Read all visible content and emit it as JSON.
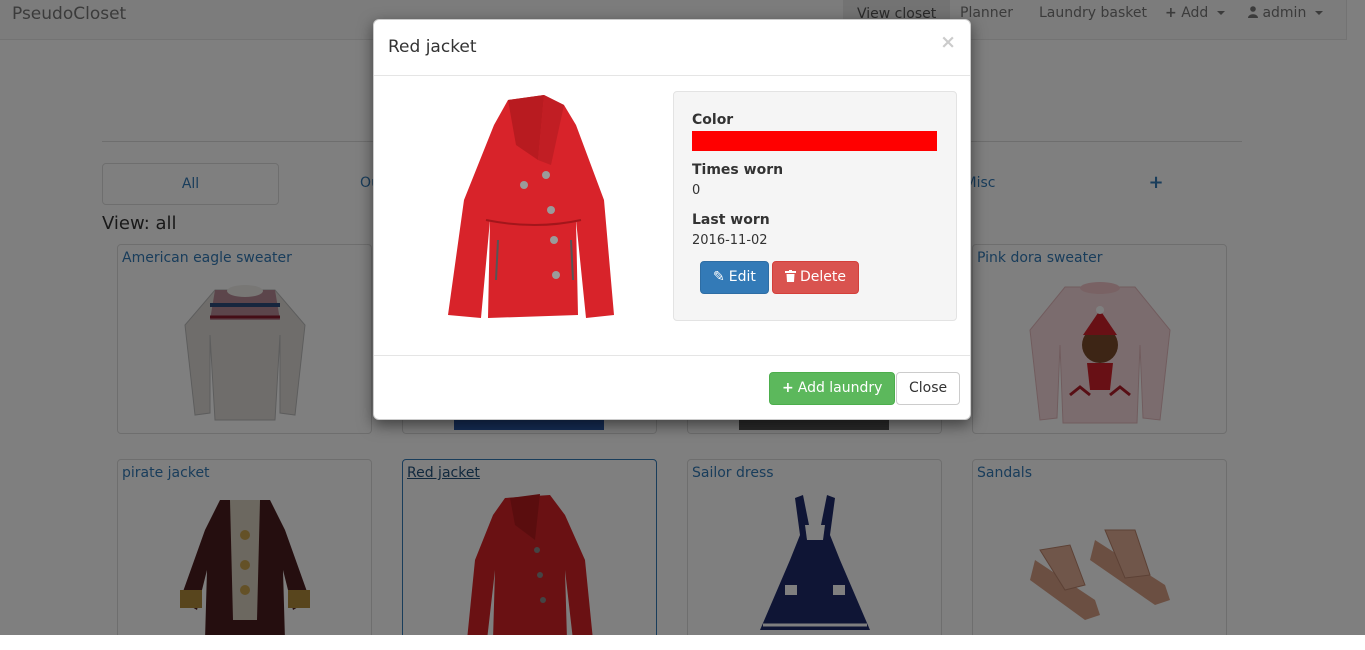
{
  "navbar": {
    "brand": "PseudoCloset",
    "items": [
      {
        "label": "View closet",
        "active": true
      },
      {
        "label": "Planner"
      },
      {
        "label": "Laundry basket"
      },
      {
        "label": "Add",
        "icon": "plus-icon"
      },
      {
        "label": "admin",
        "icon": "user-icon"
      }
    ]
  },
  "categories": {
    "all": "All",
    "outerwear_partial": "Ou",
    "misc_partial": "Misc",
    "add": "+"
  },
  "view_label": "View: all",
  "cards": [
    {
      "title": "American eagle sweater"
    },
    {
      "title": "Pink dora sweater"
    },
    {
      "title": "pirate jacket"
    },
    {
      "title": "Red jacket"
    },
    {
      "title": "Sailor dress"
    },
    {
      "title": "Sandals"
    }
  ],
  "modal": {
    "title": "Red jacket",
    "close_symbol": "×",
    "color_label": "Color",
    "color_value": "#ff0000",
    "times_worn_label": "Times worn",
    "times_worn_value": "0",
    "last_worn_label": "Last worn",
    "last_worn_value": "2016-11-02",
    "edit_label": "Edit",
    "delete_label": "Delete",
    "add_laundry_label": "Add laundry",
    "close_label": "Close"
  },
  "colors": {
    "primary": "#337ab7",
    "danger": "#d9534f",
    "success": "#5cb85c"
  }
}
